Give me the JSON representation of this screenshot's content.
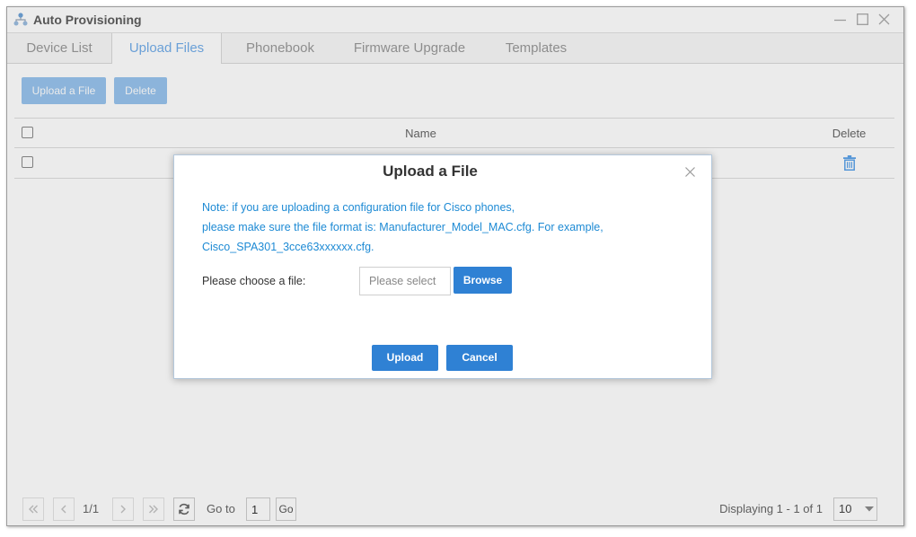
{
  "window": {
    "title": "Auto Provisioning",
    "icon": "provisioning-network-icon",
    "controls": [
      "minimize-icon",
      "maximize-icon",
      "close-icon"
    ]
  },
  "tabs": [
    {
      "label": "Device List",
      "active": false
    },
    {
      "label": "Upload Files",
      "active": true
    },
    {
      "label": "Phonebook",
      "active": false
    },
    {
      "label": "Firmware Upgrade",
      "active": false
    },
    {
      "label": "Templates",
      "active": false
    }
  ],
  "toolbar": {
    "upload_label": "Upload a File",
    "delete_label": "Delete"
  },
  "table": {
    "columns": {
      "name": "Name",
      "delete": "Delete"
    },
    "header_selected": false,
    "rows": [
      {
        "selected": false,
        "delete_icon": "trash-icon"
      }
    ]
  },
  "dialog": {
    "title": "Upload a File",
    "close_icon": "close-icon",
    "note_lines": [
      "Note: if you are uploading a configuration file for Cisco phones,",
      "please make sure the file format is: Manufacturer_Model_MAC.cfg. For example,",
      "Cisco_SPA301_3cce63xxxxxx.cfg."
    ],
    "file_label": "Please choose a file:",
    "file_placeholder": "Please select",
    "browse_label": "Browse",
    "upload_label": "Upload",
    "cancel_label": "Cancel"
  },
  "pagination": {
    "first_icon": "first-page-icon",
    "prev_icon": "prev-page-icon",
    "page_display": "1/1",
    "next_icon": "next-page-icon",
    "last_icon": "last-page-icon",
    "refresh_icon": "refresh-icon",
    "goto_label": "Go to",
    "goto_value": "1",
    "go_label": "Go",
    "summary": "Displaying 1 - 1 of 1",
    "page_size": "10"
  },
  "colors": {
    "accent": "#2f81d4",
    "note_text": "#1d8ad4",
    "toolbar_button": "#98c4ee",
    "active_tab_text": "#74aeea",
    "delete_icon": "#5ca3ea",
    "overlay": "rgba(0,0,0,0.08)"
  }
}
